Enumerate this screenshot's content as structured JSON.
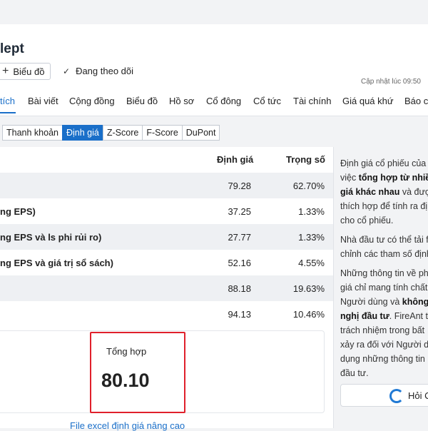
{
  "header": {
    "title": "lept",
    "chart_button": "Biểu đồ",
    "follow_label": "Đang theo dõi",
    "updated": "Cập nhật lúc  09:50"
  },
  "tabs": [
    "tích",
    "Bài viết",
    "Cộng đồng",
    "Biểu đồ",
    "Hồ sơ",
    "Cổ đông",
    "Cổ tức",
    "Tài chính",
    "Giá quá khứ",
    "Báo c"
  ],
  "active_tab_index": 0,
  "subtabs": [
    "Thanh khoản",
    "Định giá",
    "Z-Score",
    "F-Score",
    "DuPont"
  ],
  "active_subtab_index": 1,
  "table": {
    "col_value": "Định giá",
    "col_weight": "Trọng số",
    "rows": [
      {
        "label": "",
        "value": "79.28",
        "weight": "62.70%"
      },
      {
        "label": "ng EPS)",
        "value": "37.25",
        "weight": "1.33%"
      },
      {
        "label": "ng EPS và ls phi rủi ro)",
        "value": "27.77",
        "weight": "1.33%"
      },
      {
        "label": "ng EPS và giá trị sổ sách)",
        "value": "52.16",
        "weight": "4.55%"
      },
      {
        "label": "",
        "value": "88.18",
        "weight": "19.63%"
      },
      {
        "label": "",
        "value": "94.13",
        "weight": "10.46%"
      }
    ]
  },
  "summary": {
    "label": "Tổng hợp",
    "value": "80.10"
  },
  "excel_link": "File excel định giá nâng cao",
  "notes": {
    "p1_l1": "Định giá cổ phiếu của",
    "p1_l2a": "việc ",
    "p1_l2b": "tổng hợp từ nhiề",
    "p1_l3a": "giá khác nhau",
    "p1_l3b": " và được",
    "p1_l4": "thích hợp để tính ra đị",
    "p1_l5": "cho cổ phiếu.",
    "p2_l1": "Nhà đầu tư có thể tải f",
    "p2_l2": "chỉnh các tham số định",
    "p3_l1": "Những thông tin về ph",
    "p3_l2": "giá chỉ mang tính chất",
    "p3_l3a": "Người dùng và ",
    "p3_l3b": "không",
    "p3_l4a": "nghị đầu tư",
    "p3_l4b": ". FireAnt t",
    "p3_l5": "trách nhiệm trong bất",
    "p3_l6": "xảy ra đối với Người d",
    "p3_l7": "dụng những thông tin",
    "p3_l8": "đầu tư."
  },
  "ask_button": "Hỏi C",
  "colors": {
    "accent": "#1a6fc9",
    "highlight_border": "#e0202b",
    "stripe": "#eef0f3"
  }
}
